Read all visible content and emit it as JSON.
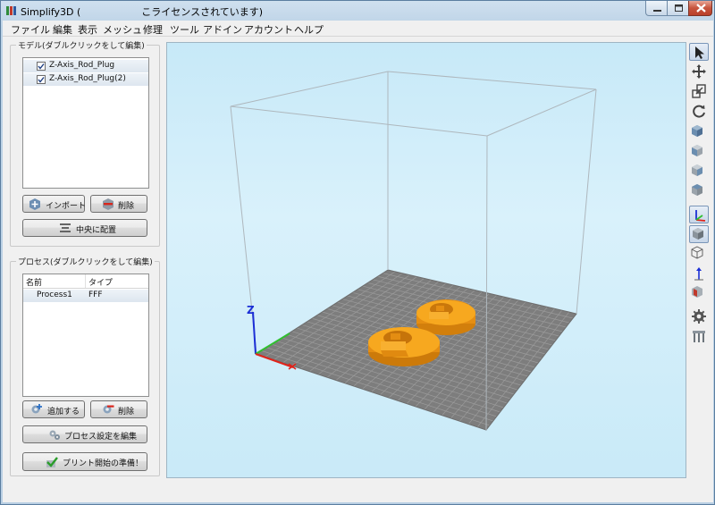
{
  "window": {
    "title_left": "Simplify3D (",
    "title_right": "こライセンスされています)"
  },
  "menu": [
    "ファイル",
    "編集",
    "表示",
    "メッシュ",
    "修理",
    "ツール",
    "アドイン",
    "アカウント",
    "ヘルプ"
  ],
  "models_panel": {
    "title": "モデル(ダブルクリックをして編集)",
    "items": [
      {
        "label": "Z-Axis_Rod_Plug",
        "checked": true
      },
      {
        "label": "Z-Axis_Rod_Plug(2)",
        "checked": true
      }
    ],
    "import_button": "インポート",
    "delete_button": "削除",
    "center_button": "中央に配置"
  },
  "process_panel": {
    "title": "プロセス(ダブルクリックをして編集)",
    "columns": [
      "名前",
      "タイプ"
    ],
    "rows": [
      {
        "name": "Process1",
        "type": "FFF"
      }
    ],
    "add_button": "追加する",
    "delete_button": "削除",
    "edit_button": "プロセス設定を編集",
    "prepare_button": "プリント開始の準備！"
  },
  "viewport": {
    "axis_label_z": "Z",
    "colors": {
      "bed": "#808080",
      "model": "#f5a21c",
      "axis_x": "#e0241b",
      "axis_y": "#2fbf2f",
      "axis_z": "#1c2fd6"
    }
  },
  "toolbar": {
    "tools": [
      "select-tool",
      "move-tool",
      "scale-tool",
      "rotate-tool",
      "view-default",
      "view-front",
      "view-side",
      "view-top",
      "axes-toggle",
      "solid-view",
      "wireframe-view",
      "normals-view",
      "cross-section",
      "settings",
      "machine-view"
    ]
  }
}
